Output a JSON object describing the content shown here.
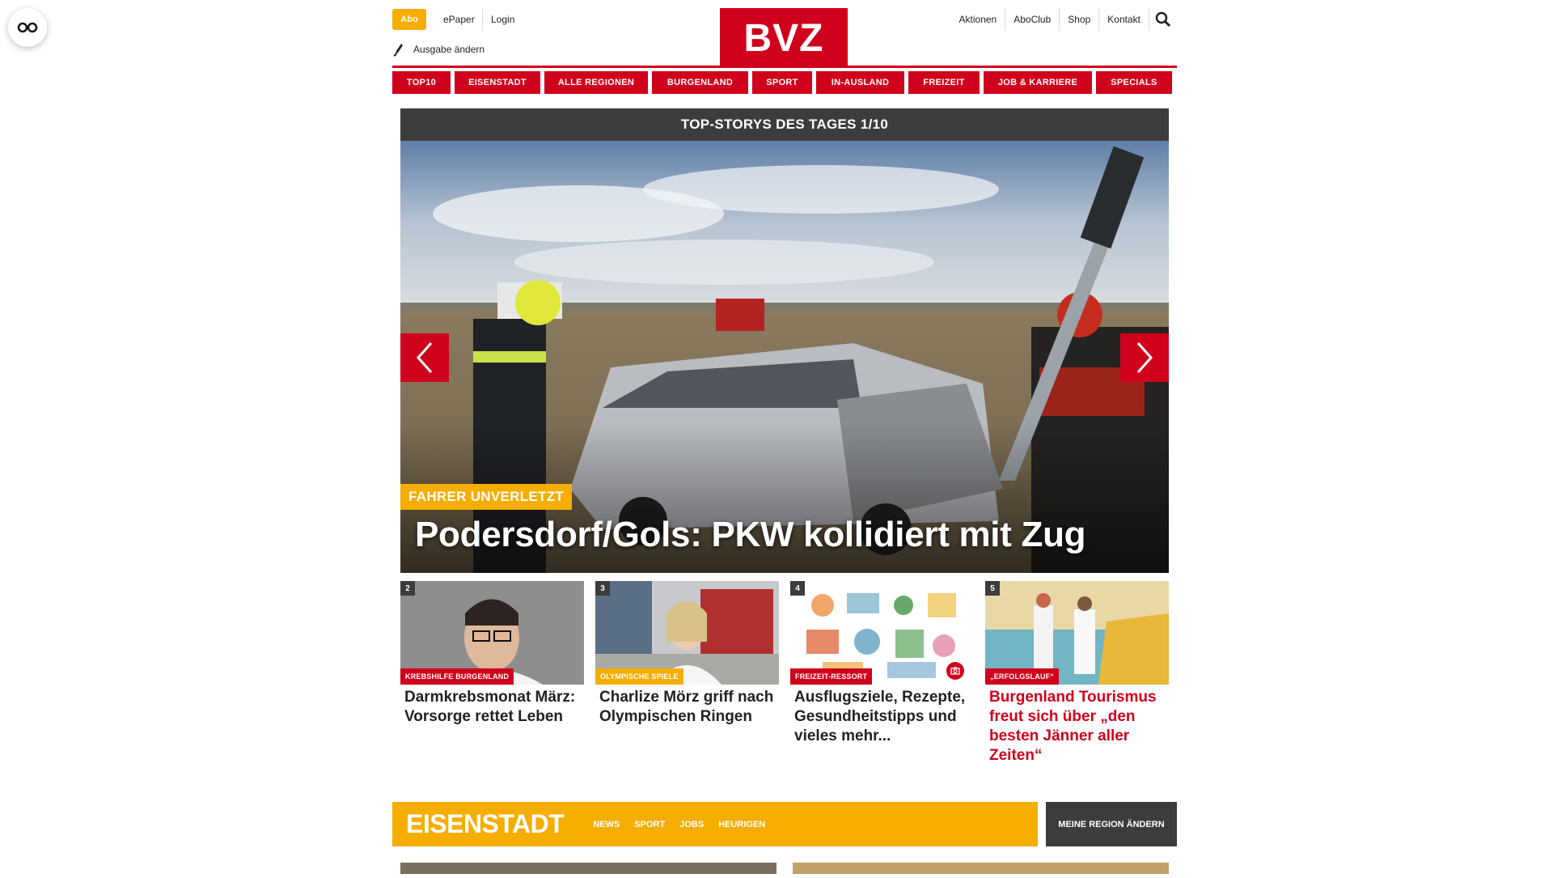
{
  "header": {
    "abo": "Abo",
    "epaper": "ePaper",
    "login": "Login",
    "edition": "Ausgabe ändern",
    "logo": "BVZ",
    "right_links": [
      "Aktionen",
      "AboClub",
      "Shop",
      "Kontakt"
    ]
  },
  "nav": [
    "TOP10",
    "EISENSTADT",
    "ALLE REGIONEN",
    "BURGENLAND",
    "SPORT",
    "IN-AUSLAND",
    "FREIZEIT",
    "JOB & KARRIERE",
    "SPECIALS"
  ],
  "slider": {
    "heading": "TOP-STORYS DES TAGES 1/10",
    "kicker": "FAHRER UNVERLETZT",
    "title": "Podersdorf/Gols: PKW kollidiert mit Zug"
  },
  "tiles": [
    {
      "num": "2",
      "tag": "KREBSHILFE BURGENLAND",
      "tag_color": "#d0021b",
      "title": "Darmkrebsmonat März: Vorsorge rettet Leben",
      "title_color": "#222222"
    },
    {
      "num": "3",
      "tag": "OLYMPISCHE SPIELE",
      "tag_color": "#f5ad00",
      "title": "Charlize Mörz griff nach Olympischen Ringen",
      "title_color": "#222222"
    },
    {
      "num": "4",
      "tag": "FREIZEIT-RESSORT",
      "tag_color": "#d0021b",
      "title": "Ausflugsziele, Rezepte, Gesundheitstipps und vieles mehr...",
      "title_color": "#222222"
    },
    {
      "num": "5",
      "tag": "„ERFOLGSLAUF“",
      "tag_color": "#d0021b",
      "title": "Burgenland Tourismus freut sich über „den besten Jänner aller Zeiten“",
      "title_color": "#d0021b"
    }
  ],
  "region": {
    "name": "EISENSTADT",
    "links": [
      "NEWS",
      "SPORT",
      "JOBS",
      "HEURIGEN"
    ],
    "change": "MEINE REGION ÄNDERN"
  },
  "colors": {
    "brand_red": "#d0021b",
    "accent_yellow": "#f5ad00",
    "dark": "#3c3c3c"
  }
}
